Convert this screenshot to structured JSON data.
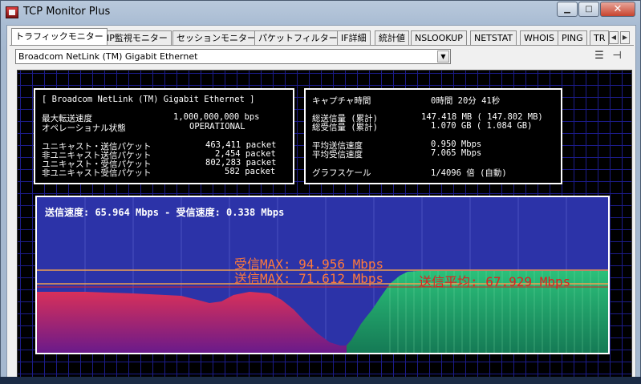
{
  "window": {
    "title": "TCP Monitor Plus"
  },
  "tabs": [
    "トラフィックモニター",
    "IP監視モニター",
    "セッションモニター",
    "パケットフィルター",
    "IF詳細",
    "統計値",
    "NSLOOKUP",
    "NETSTAT",
    "WHOIS",
    "PING",
    "TR"
  ],
  "adapter": {
    "selected": "Broadcom NetLink (TM) Gigabit Ethernet"
  },
  "left_panel": {
    "adapter_name": "[ Broadcom NetLink (TM) Gigabit Ethernet ]",
    "rows": [
      {
        "label": "最大転送速度",
        "value": "1,000,000,000 bps"
      },
      {
        "label": "オペレーショナル状態",
        "value": "OPERATIONAL"
      },
      {
        "label": "ユニキャスト・送信パケット",
        "value": "463,411 packet"
      },
      {
        "label": "非ユニキャスト送信パケット",
        "value": "2,454 packet"
      },
      {
        "label": "ユニキャスト・受信パケット",
        "value": "802,283 packet"
      },
      {
        "label": "非ユニキャスト受信パケット",
        "value": "582 packet"
      }
    ]
  },
  "right_panel": {
    "capture_label": "キャプチャ時間",
    "capture_value": "0時間 20分 41秒",
    "sent_total_label": "総送信量 (累計)",
    "sent_total_value": "147.418 MB ( 147.802 MB)",
    "recv_total_label": "総受信量 (累計)",
    "recv_total_value": "1.070 GB (   1.084 GB)",
    "avg_send_label": "平均送信速度",
    "avg_send_value": "0.950 Mbps",
    "avg_recv_label": "平均受信速度",
    "avg_recv_value": "7.065 Mbps",
    "scale_label": "グラフスケール",
    "scale_value": "1/4096 倍 (自動)"
  },
  "graph": {
    "speed_text": "送信速度:  65.964 Mbps  -  受信速度:   0.338 Mbps",
    "recv_max": "受信MAX:  94.956 Mbps",
    "send_max": "送信MAX:  71.612 Mbps",
    "send_avg": "送信平均:  67.929 Mbps"
  },
  "colors": {
    "send": "#d02a4a",
    "recv": "#1fa86a",
    "max_line": "#f0a050",
    "avg": "#e02020"
  }
}
